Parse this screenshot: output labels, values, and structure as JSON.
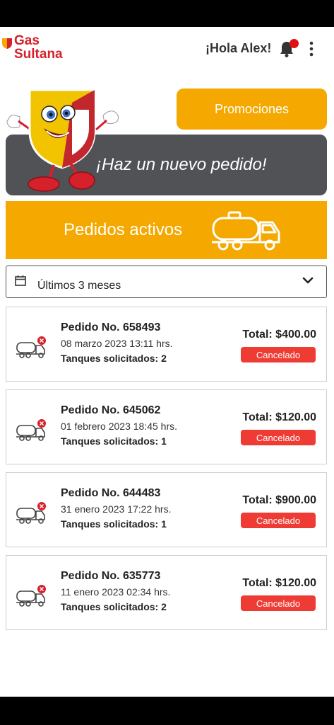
{
  "header": {
    "brand_line1": "Gas",
    "brand_line2": "Sultana",
    "greeting": "¡Hola Alex!",
    "notification_icon": "bell-icon",
    "menu_icon": "more-vertical-icon"
  },
  "actions": {
    "promotions_label": "Promociones",
    "new_order_label": "¡Haz un nuevo pedido!"
  },
  "active_orders": {
    "label": "Pedidos activos",
    "icon": "tanker-truck-icon"
  },
  "filter": {
    "icon": "calendar-icon",
    "selected": "Últimos 3 meses",
    "dropdown_icon": "chevron-down-icon"
  },
  "orders": [
    {
      "title": "Pedido No. 658493",
      "date": "08 marzo 2023 13:11 hrs.",
      "tanks": "Tanques solicitados: 2",
      "total": "Total: $400.00",
      "status": "Cancelado"
    },
    {
      "title": "Pedido No. 645062",
      "date": "01 febrero 2023 18:45 hrs.",
      "tanks": "Tanques solicitados: 1",
      "total": "Total: $120.00",
      "status": "Cancelado"
    },
    {
      "title": "Pedido No. 644483",
      "date": "31 enero 2023 17:22 hrs.",
      "tanks": "Tanques solicitados: 1",
      "total": "Total: $900.00",
      "status": "Cancelado"
    },
    {
      "title": "Pedido No. 635773",
      "date": "11 enero 2023 02:34 hrs.",
      "tanks": "Tanques solicitados: 2",
      "total": "Total: $120.00",
      "status": "Cancelado"
    }
  ],
  "colors": {
    "brand_red": "#d6202c",
    "accent_yellow": "#f5a800",
    "dark_panel": "#505256",
    "status_red": "#ee3b34"
  }
}
